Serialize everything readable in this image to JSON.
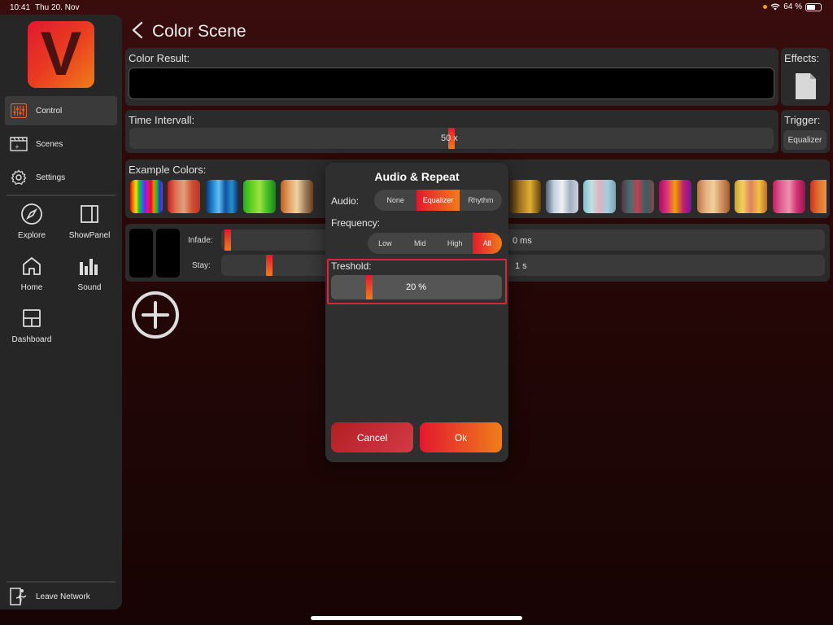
{
  "status_bar": {
    "time": "10:41",
    "date": "Thu 20. Nov",
    "battery": "64 %",
    "battery_level": 0.64
  },
  "sidebar": {
    "logo_letter": "V",
    "items": [
      {
        "label": "Control",
        "icon": "equalizer-icon",
        "active": true
      },
      {
        "label": "Scenes",
        "icon": "clapperboard-icon"
      },
      {
        "label": "Settings",
        "icon": "gear-icon"
      }
    ],
    "grid": [
      {
        "label": "Explore",
        "icon": "compass-icon"
      },
      {
        "label": "ShowPanel",
        "icon": "panel-icon"
      },
      {
        "label": "Home",
        "icon": "house-icon"
      },
      {
        "label": "Sound",
        "icon": "bars-icon"
      },
      {
        "label": "Dashboard",
        "icon": "dashboard-icon"
      }
    ],
    "leave": {
      "label": "Leave Network",
      "icon": "exit-icon"
    }
  },
  "header": {
    "title": "Color Scene"
  },
  "color_result": {
    "label": "Color Result:"
  },
  "effects": {
    "label": "Effects:",
    "icon": "document-icon"
  },
  "time_interval": {
    "label": "Time Intervall:",
    "value_text": "50 x",
    "level": 0.5
  },
  "trigger": {
    "label": "Trigger:",
    "value": "Equalizer"
  },
  "example_colors": {
    "label": "Example Colors:"
  },
  "scene_row": {
    "infade_label": "Infade:",
    "infade_value": "0 ms",
    "infade_level": 0.0,
    "stay_label": "Stay:",
    "stay_value": "1 s",
    "stay_level": 0.07
  },
  "dialog": {
    "title": "Audio & Repeat",
    "audio_label": "Audio:",
    "audio_options": [
      "None",
      "Equalizer",
      "Rhythm"
    ],
    "audio_selected": "Equalizer",
    "frequency_label": "Frequency:",
    "frequency_options": [
      "Low",
      "Mid",
      "High",
      "All"
    ],
    "frequency_selected": "All",
    "threshold_label": "Treshold:",
    "threshold_value": "20 %",
    "threshold_level": 0.2,
    "cancel_label": "Cancel",
    "ok_label": "Ok"
  },
  "colors": {
    "accent_start": "#e3182e",
    "accent_end": "#f07d1a",
    "highlight": "#d8263a"
  }
}
